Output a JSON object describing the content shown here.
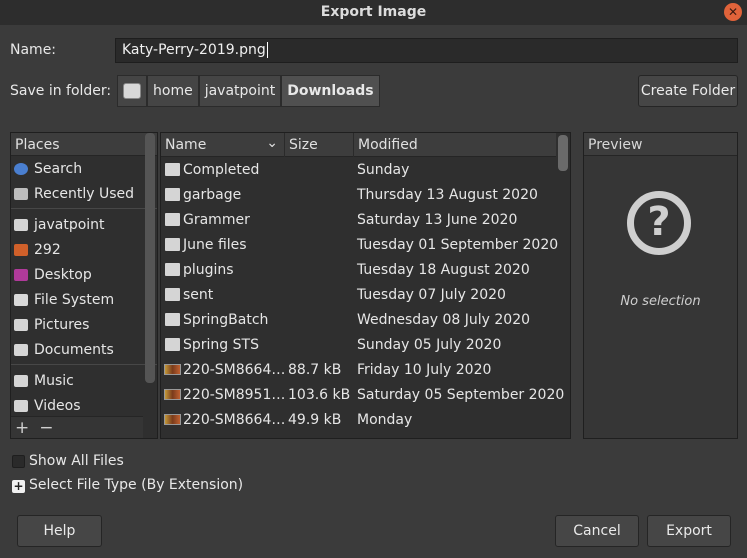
{
  "window": {
    "title": "Export Image",
    "close_glyph": "✕"
  },
  "name_label": "Name:",
  "file_name": "Katy-Perry-2019.png",
  "folder_label": "Save in folder:",
  "breadcrumbs": [
    "home",
    "javatpoint",
    "Downloads"
  ],
  "create_folder": "Create Folder",
  "places": {
    "header": "Places",
    "items": [
      {
        "label": "Search",
        "icon": "search-icon",
        "color": "#4a7fd0"
      },
      {
        "label": "Recently Used",
        "icon": "clock-icon",
        "color": "#bdbdbd"
      },
      {
        "label": "javatpoint",
        "icon": "home-folder-icon",
        "color": "#d5d5d5"
      },
      {
        "label": "292",
        "icon": "image-icon",
        "color": "#d0602a"
      },
      {
        "label": "Desktop",
        "icon": "desktop-icon",
        "color": "#b03a9a"
      },
      {
        "label": "File System",
        "icon": "drive-icon",
        "color": "#d8d8d8"
      },
      {
        "label": "Pictures",
        "icon": "folder-icon",
        "color": "#d5d5d5"
      },
      {
        "label": "Documents",
        "icon": "folder-icon",
        "color": "#d5d5d5"
      },
      {
        "label": "Music",
        "icon": "folder-icon",
        "color": "#d5d5d5"
      },
      {
        "label": "Videos",
        "icon": "folder-icon",
        "color": "#d5d5d5"
      }
    ],
    "add_glyph": "+",
    "remove_glyph": "−"
  },
  "files": {
    "columns": {
      "name": "Name",
      "size": "Size",
      "modified": "Modified",
      "sort_glyph": "⌄"
    },
    "rows": [
      {
        "name": "Completed",
        "size": "",
        "modified": "Sunday",
        "type": "folder"
      },
      {
        "name": "garbage",
        "size": "",
        "modified": "Thursday 13 August 2020",
        "type": "folder"
      },
      {
        "name": "Grammer",
        "size": "",
        "modified": "Saturday 13 June 2020",
        "type": "folder"
      },
      {
        "name": "June files",
        "size": "",
        "modified": "Tuesday 01 September 2020",
        "type": "folder"
      },
      {
        "name": "plugins",
        "size": "",
        "modified": "Tuesday 18 August 2020",
        "type": "folder"
      },
      {
        "name": "sent",
        "size": "",
        "modified": "Tuesday 07 July 2020",
        "type": "folder"
      },
      {
        "name": "SpringBatch",
        "size": "",
        "modified": "Wednesday 08 July 2020",
        "type": "folder"
      },
      {
        "name": "Spring STS",
        "size": "",
        "modified": "Sunday 05 July 2020",
        "type": "folder"
      },
      {
        "name": "220-SM8664…",
        "size": "88.7 kB",
        "modified": "Friday 10 July 2020",
        "type": "image"
      },
      {
        "name": "220-SM8951…",
        "size": "103.6 kB",
        "modified": "Saturday 05 September 2020",
        "type": "image"
      },
      {
        "name": "220-SM8664…",
        "size": "49.9 kB",
        "modified": "Monday",
        "type": "image"
      }
    ]
  },
  "preview": {
    "header": "Preview",
    "glyph": "?",
    "empty_text": "No selection"
  },
  "show_all_files": "Show All Files",
  "select_file_type": "Select File Type (By Extension)",
  "expander_glyph": "+",
  "buttons": {
    "help": "Help",
    "cancel": "Cancel",
    "export": "Export"
  }
}
